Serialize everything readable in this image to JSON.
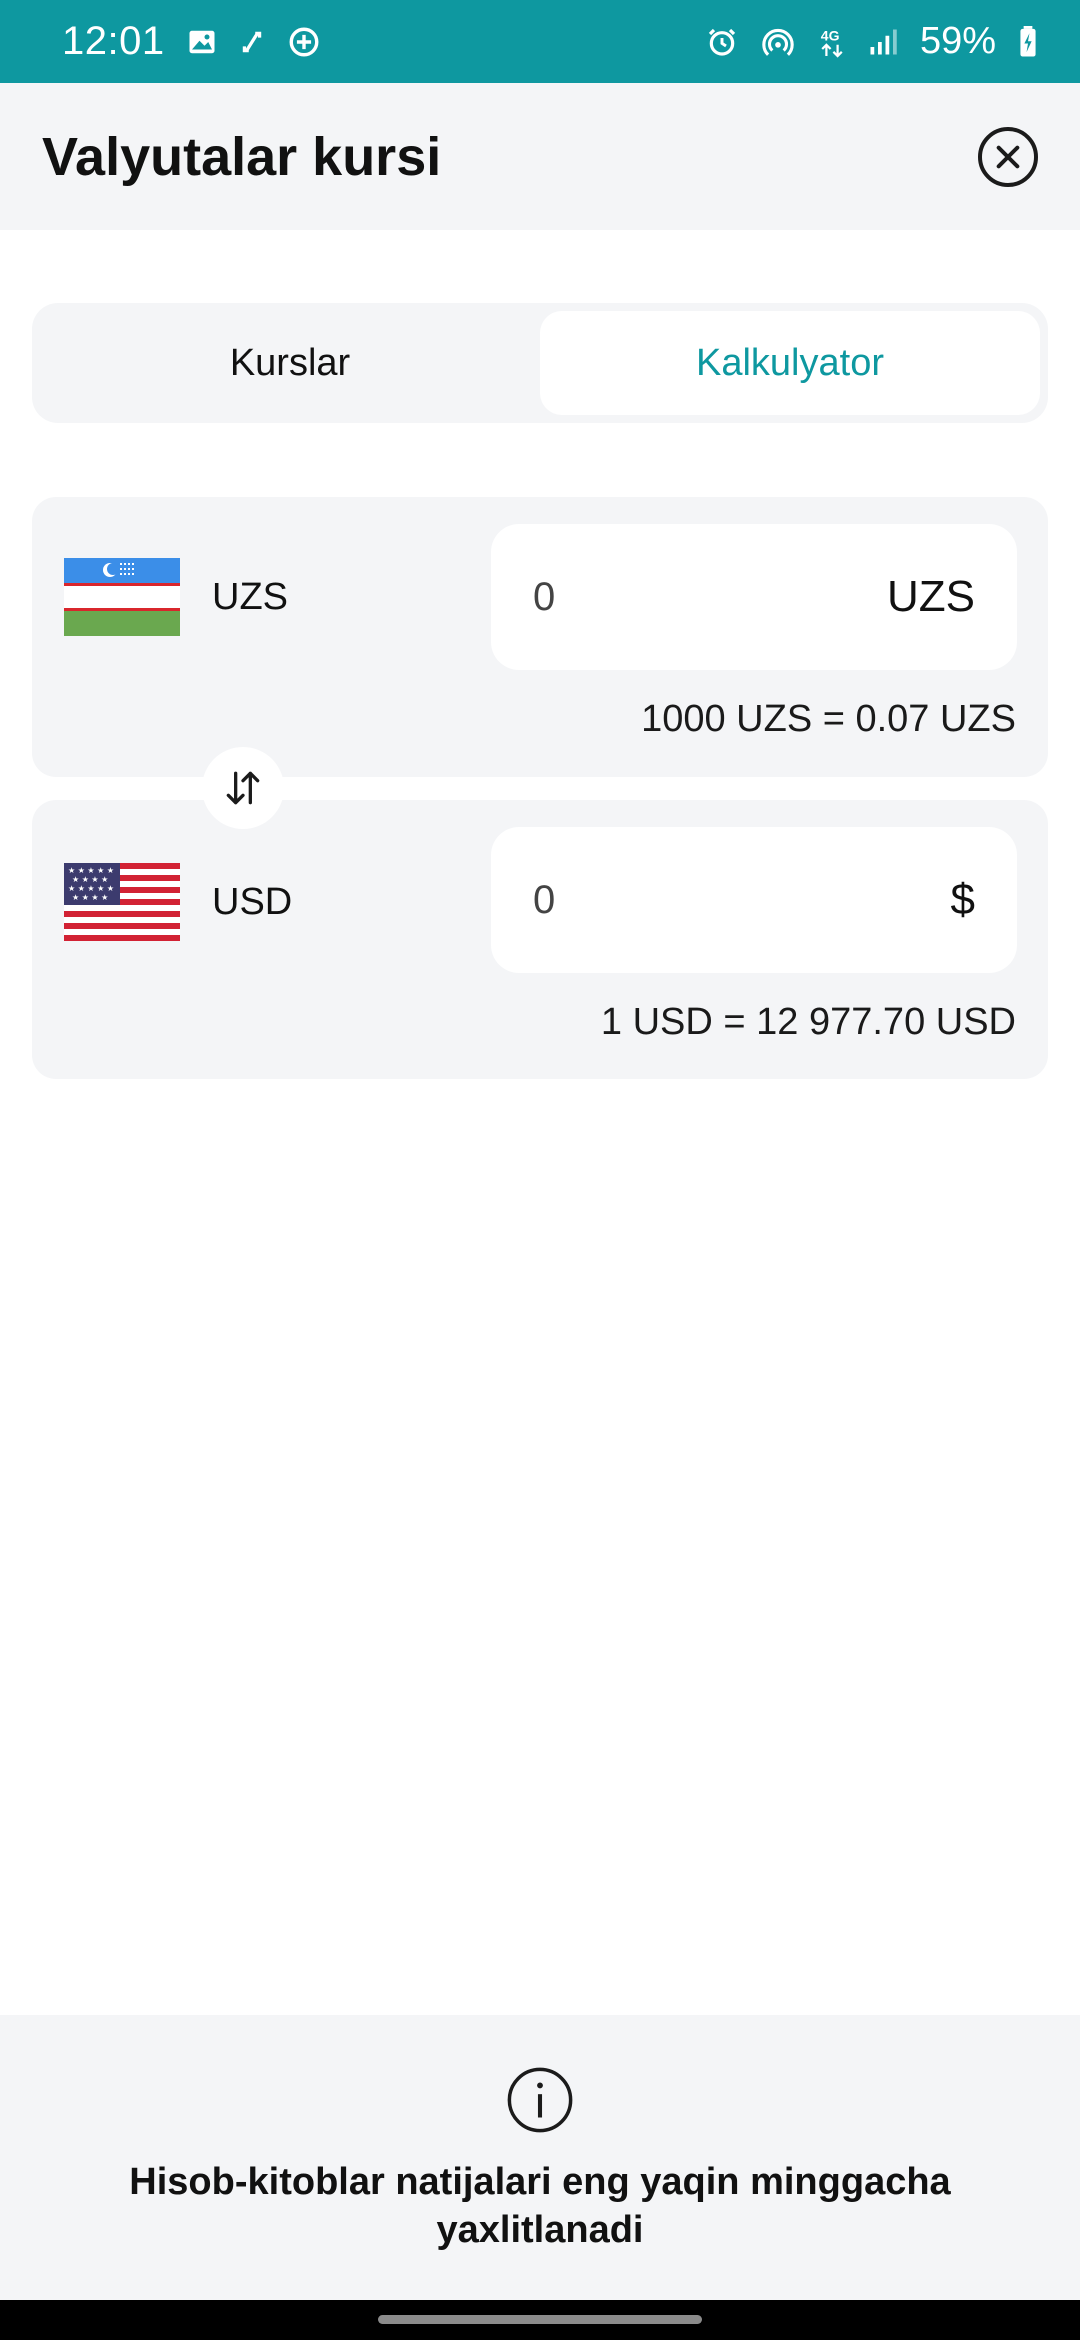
{
  "status_bar": {
    "time": "12:01",
    "battery": "59%",
    "left_icons": [
      "gallery-icon",
      "sync-icon",
      "messenger-icon"
    ],
    "right_icons": [
      "alarm-icon",
      "hotspot-icon",
      "4g-icon",
      "signal-icon",
      "battery-charging-icon"
    ]
  },
  "header": {
    "title": "Valyutalar kursi",
    "close_icon": "close-circle-icon"
  },
  "tabs": [
    {
      "label": "Kurslar",
      "active": false
    },
    {
      "label": "Kalkulyator",
      "active": true
    }
  ],
  "converter": {
    "from": {
      "code": "UZS",
      "flag": "uzbekistan-flag",
      "amount": "0",
      "unit": "UZS",
      "rate": "1000 UZS = 0.07 UZS"
    },
    "to": {
      "code": "USD",
      "flag": "usa-flag",
      "amount": "0",
      "unit": "$",
      "rate": "1 USD = 12 977.70 USD"
    },
    "swap_icon": "swap-vertical-icon"
  },
  "footer": {
    "info_icon": "info-icon",
    "text": "Hisob-kitoblar natijalari eng yaqin minggacha yaxlitlanadi"
  },
  "colors": {
    "accent": "#0e98a0",
    "surface": "#f4f5f7"
  }
}
